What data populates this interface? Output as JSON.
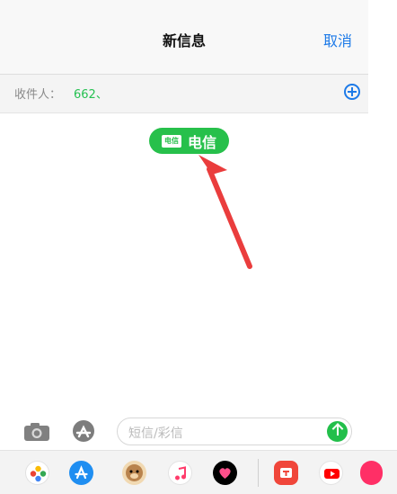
{
  "header": {
    "title": "新信息",
    "cancel_label": "取消"
  },
  "recipient_bar": {
    "label": "收件人：",
    "value": "662、",
    "add_icon": "add-contact-icon"
  },
  "carrier_tag": {
    "icon_text": "电信",
    "label": "电信"
  },
  "composer": {
    "placeholder": "短信/彩信",
    "camera_icon": "camera-icon",
    "apps_icon": "apps-icon",
    "send_icon": "send-icon"
  },
  "dock": {
    "apps": [
      "photos-icon",
      "app-store-icon",
      "animoji-icon",
      "music-icon",
      "digital-touch-icon",
      "app-icon-red",
      "youtube-icon",
      "extra-app-icon"
    ]
  },
  "colors": {
    "accent_blue": "#1d7ae8",
    "accent_green": "#27c04b",
    "annotation_red": "#ea3d3d"
  }
}
